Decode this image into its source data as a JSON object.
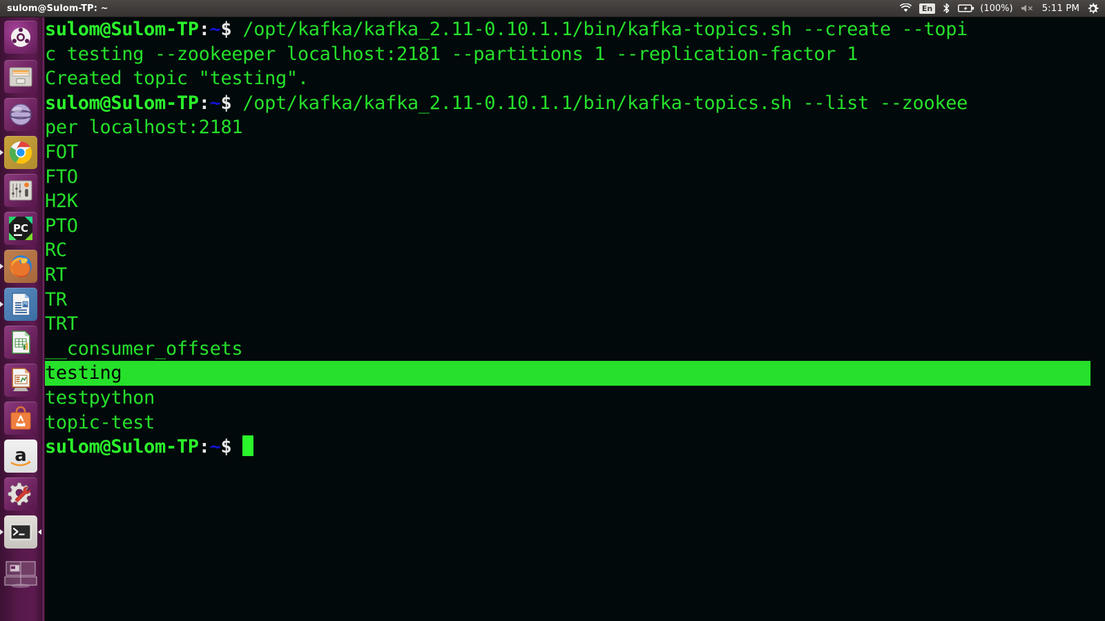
{
  "window": {
    "title": "sulom@Sulom-TP: ~"
  },
  "top_panel": {
    "indicators": [
      {
        "name": "wifi-icon",
        "label": ""
      },
      {
        "name": "keyboard-layout-indicator",
        "label": "En"
      },
      {
        "name": "bluetooth-icon",
        "label": ""
      },
      {
        "name": "battery-icon",
        "label": "(100%)"
      },
      {
        "name": "volume-muted-icon",
        "label": ""
      },
      {
        "name": "clock",
        "label": "5:11 PM"
      },
      {
        "name": "system-menu-gear-icon",
        "label": ""
      }
    ],
    "keyboard_layout": "En",
    "battery_percent": "(100%)",
    "clock": "5:11 PM"
  },
  "launcher": {
    "items": [
      {
        "name": "launcher-item-dash",
        "label": "Ubuntu Dash",
        "icon": "ubuntu-logo-icon",
        "running": false
      },
      {
        "name": "launcher-item-files",
        "label": "Files",
        "icon": "file-cabinet-icon",
        "running": false
      },
      {
        "name": "launcher-item-rhythmbox",
        "label": "Rhythmbox",
        "icon": "music-globe-icon",
        "running": false
      },
      {
        "name": "launcher-item-chrome",
        "label": "Google Chrome",
        "icon": "chrome-icon",
        "running": true
      },
      {
        "name": "launcher-item-audio-mixer",
        "label": "Audio Mixer",
        "icon": "sliders-icon",
        "running": false
      },
      {
        "name": "launcher-item-pycharm",
        "label": "PyCharm",
        "icon": "pycharm-icon",
        "running": false
      },
      {
        "name": "launcher-item-firefox",
        "label": "Firefox",
        "icon": "firefox-icon",
        "running": true
      },
      {
        "name": "launcher-item-libreoffice-writer",
        "label": "LibreOffice Writer",
        "icon": "document-icon",
        "running": true
      },
      {
        "name": "launcher-item-libreoffice-calc",
        "label": "LibreOffice Calc",
        "icon": "spreadsheet-icon",
        "running": false
      },
      {
        "name": "launcher-item-libreoffice-impress",
        "label": "LibreOffice Impress",
        "icon": "presentation-icon",
        "running": false
      },
      {
        "name": "launcher-item-software-center",
        "label": "Ubuntu Software Center",
        "icon": "software-bag-icon",
        "running": false
      },
      {
        "name": "launcher-item-amazon",
        "label": "Amazon",
        "icon": "amazon-icon",
        "running": false
      },
      {
        "name": "launcher-item-system-settings",
        "label": "System Settings",
        "icon": "gear-wrench-icon",
        "running": false
      },
      {
        "name": "launcher-item-terminal",
        "label": "Terminal",
        "icon": "terminal-icon",
        "running": true
      },
      {
        "name": "launcher-item-workspace-switcher",
        "label": "Workspace Switcher",
        "icon": "workspace-switcher-icon",
        "running": false
      }
    ]
  },
  "terminal": {
    "prompt": {
      "user_host": "sulom@Sulom-TP",
      "colon": ":",
      "path": "~",
      "dollar": "$"
    },
    "lines": [
      {
        "type": "prompt",
        "command": " /opt/kafka/kafka_2.11-0.10.1.1/bin/kafka-topics.sh --create --topi"
      },
      {
        "type": "output",
        "text": "c testing --zookeeper localhost:2181 --partitions 1 --replication-factor 1"
      },
      {
        "type": "output",
        "text": "Created topic \"testing\"."
      },
      {
        "type": "prompt",
        "command": " /opt/kafka/kafka_2.11-0.10.1.1/bin/kafka-topics.sh --list --zookee"
      },
      {
        "type": "output",
        "text": "per localhost:2181"
      },
      {
        "type": "output",
        "text": "FOT"
      },
      {
        "type": "output",
        "text": "FTO"
      },
      {
        "type": "output",
        "text": "H2K"
      },
      {
        "type": "output",
        "text": "PTO"
      },
      {
        "type": "output",
        "text": "RC"
      },
      {
        "type": "output",
        "text": "RT"
      },
      {
        "type": "output",
        "text": "TR"
      },
      {
        "type": "output",
        "text": "TRT"
      },
      {
        "type": "output",
        "text": "__consumer_offsets"
      },
      {
        "type": "selected",
        "text": "testing"
      },
      {
        "type": "output",
        "text": "testpython"
      },
      {
        "type": "output",
        "text": "topic-test"
      },
      {
        "type": "prompt-cursor",
        "command": " "
      }
    ],
    "colors": {
      "background": "#02090b",
      "foreground": "#26e02b",
      "prompt_user": "#2bf52b",
      "prompt_path": "#1414d6",
      "selection_bg": "#26e02b",
      "selection_fg": "#000000",
      "cursor": "#2bf52b"
    }
  }
}
